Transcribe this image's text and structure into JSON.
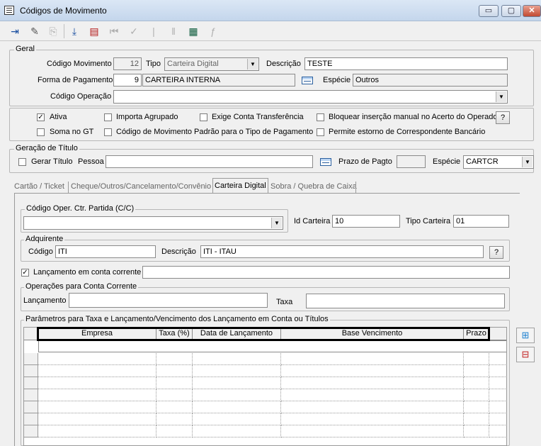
{
  "window": {
    "title": "Códigos de Movimento",
    "minimize": "▭",
    "maximize": "▢",
    "close": "✕"
  },
  "geral": {
    "legend": "Geral",
    "codigo_label": "Código Movimento",
    "codigo_value": "12",
    "tipo_label": "Tipo",
    "tipo_value": "Carteira Digital",
    "descricao_label": "Descrição",
    "descricao_value": "TESTE",
    "forma_label": "Forma de Pagamento",
    "forma_code": "9",
    "forma_desc": "CARTEIRA INTERNA",
    "especie_label": "Espécie",
    "especie_value": "Outros",
    "operacao_label": "Código Operação",
    "operacao_value": ""
  },
  "flags": {
    "ativa": "Ativa",
    "importa": "Importa Agrupado",
    "exige": "Exige Conta Transferência",
    "bloquear": "Bloquear inserção manual no Acerto do Operador",
    "soma": "Soma no GT",
    "padrao": "Código de Movimento Padrão para o Tipo de Pagamento",
    "permite": "Permite estorno de Correspondente Bancário",
    "help": "?"
  },
  "geracao": {
    "legend": "Geração de Título",
    "gerar": "Gerar Título",
    "pessoa_label": "Pessoa",
    "pessoa_value": "",
    "prazo_label": "Prazo de Pagto",
    "prazo_value": "",
    "especie_label": "Espécie",
    "especie_value": "CARTCR"
  },
  "tabs": [
    "Cartão / Ticket",
    "Cheque/Outros/Cancelamento/Convênio",
    "Carteira Digital",
    "Sobra / Quebra de Caixa"
  ],
  "carteira": {
    "partida_legend": "Código Oper. Ctr. Partida (C/C)",
    "id_label": "Id Carteira",
    "id_value": "10",
    "tipo_label": "Tipo Carteira",
    "tipo_value": "01",
    "adq_legend": "Adquirente",
    "codigo_label": "Código",
    "codigo_value": "ITI",
    "desc_label": "Descrição",
    "desc_value": "ITI - ITAU",
    "help": "?",
    "lanc_cc": "Lançamento em conta corrente",
    "ops_legend": "Operações para Conta Corrente",
    "lanc_label": "Lançamento",
    "taxa_label": "Taxa",
    "params_legend": "Parâmetros para Taxa e Lançamento/Vencimento dos Lançamento em Conta ou Títulos"
  },
  "grid": {
    "columns": [
      "Empresa",
      "Taxa (%)",
      "Data de Lançamento",
      "Base Vencimento",
      "Prazo"
    ]
  }
}
